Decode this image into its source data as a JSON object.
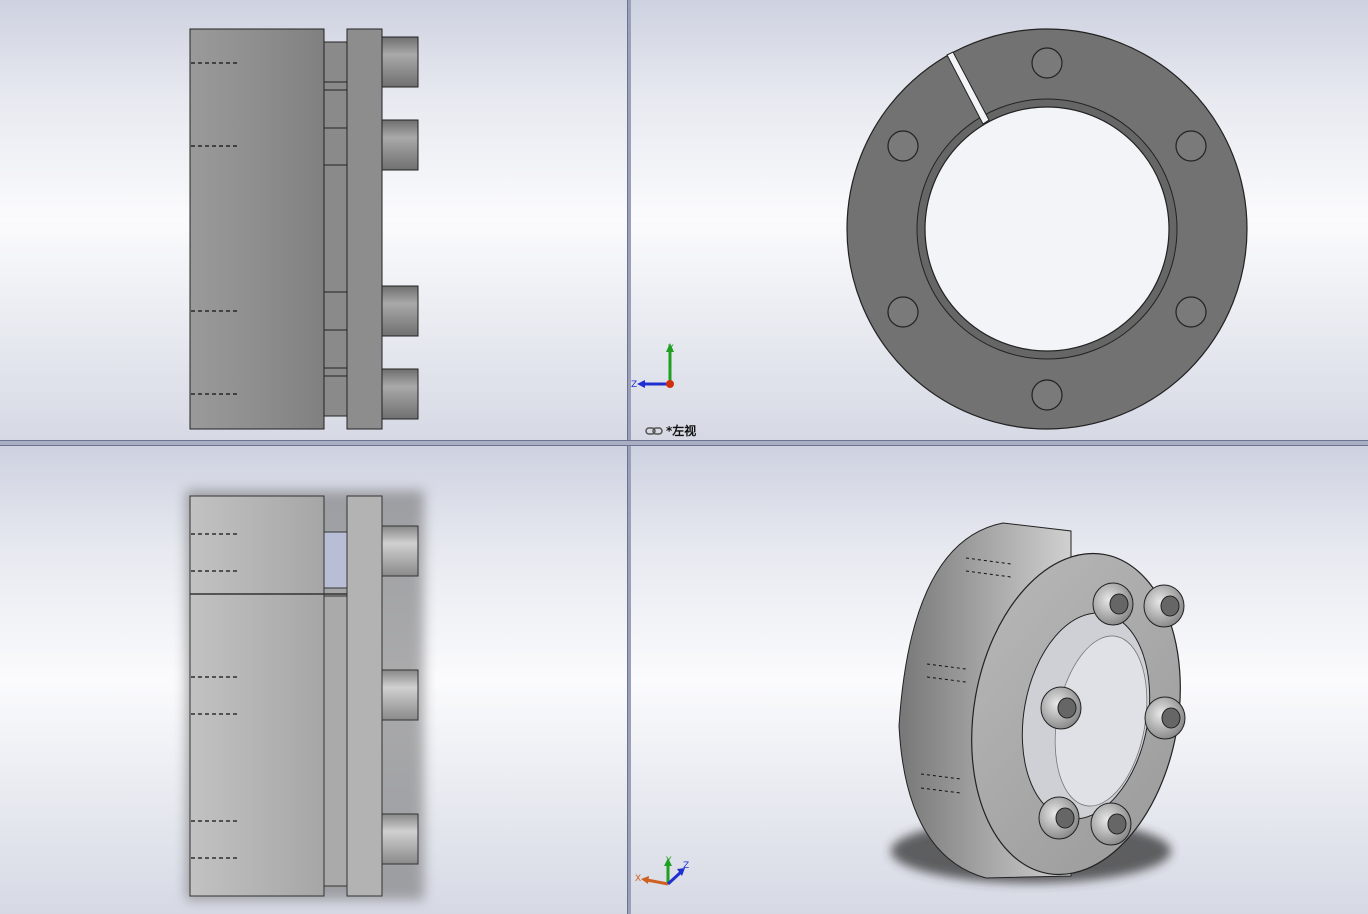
{
  "viewports": {
    "top_right": {
      "view_label": "*左视"
    }
  },
  "triad_labels": {
    "top_right": {
      "y": "Y",
      "z": "Z"
    },
    "bottom_right": {
      "x": "X",
      "y": "Y",
      "z": "Z"
    }
  },
  "colors": {
    "steel": "#8c8c8c",
    "steel_dark": "#6e6e6e",
    "axis_x": "#d03010",
    "axis_y": "#20a020",
    "axis_z": "#2030d0"
  }
}
